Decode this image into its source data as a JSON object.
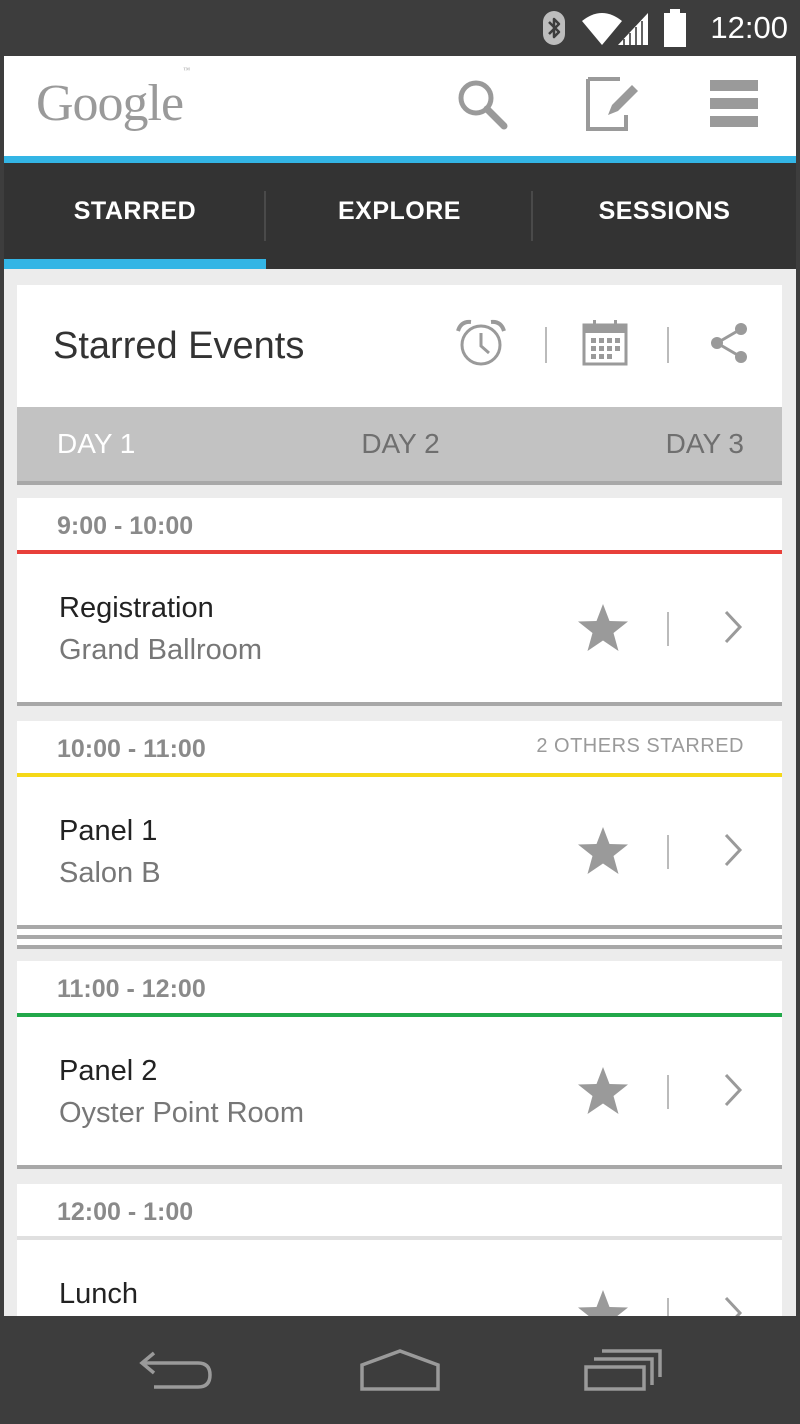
{
  "status_bar": {
    "time": "12:00",
    "icons": [
      "bluetooth-icon",
      "wifi-icon",
      "signal-icon",
      "battery-icon"
    ]
  },
  "app_bar": {
    "logo": "Google",
    "logo_tm": "™",
    "actions": [
      "search-icon",
      "edit-icon",
      "menu-icon"
    ]
  },
  "tabs": [
    {
      "label": "STARRED",
      "active": true
    },
    {
      "label": "EXPLORE",
      "active": false
    },
    {
      "label": "SESSIONS",
      "active": false
    }
  ],
  "header": {
    "title": "Starred Events",
    "actions": [
      "alarm-icon",
      "calendar-icon",
      "share-icon"
    ]
  },
  "day_tabs": [
    {
      "label": "DAY 1",
      "active": true
    },
    {
      "label": "DAY 2",
      "active": false
    },
    {
      "label": "DAY 3",
      "active": false
    }
  ],
  "events": [
    {
      "time": "9:00 - 10:00",
      "others": "",
      "name": "Registration",
      "room": "Grand Ballroom",
      "color": "#e8403a"
    },
    {
      "time": "10:00 - 11:00",
      "others": "2 OTHERS STARRED",
      "name": "Panel 1",
      "room": "Salon B",
      "color": "#f5d818"
    },
    {
      "time": "11:00 - 12:00",
      "others": "",
      "name": "Panel 2",
      "room": "Oyster Point Room",
      "color": "#22a84a"
    },
    {
      "time": "12:00 - 1:00",
      "others": "",
      "name": "Lunch",
      "room": "",
      "color": "#e0e0e0"
    }
  ],
  "colors": {
    "accent": "#33b5e5",
    "dark": "#333333",
    "status_bg": "#3d3d3d"
  },
  "nav_bar": [
    "back-icon",
    "home-icon",
    "recents-icon"
  ]
}
